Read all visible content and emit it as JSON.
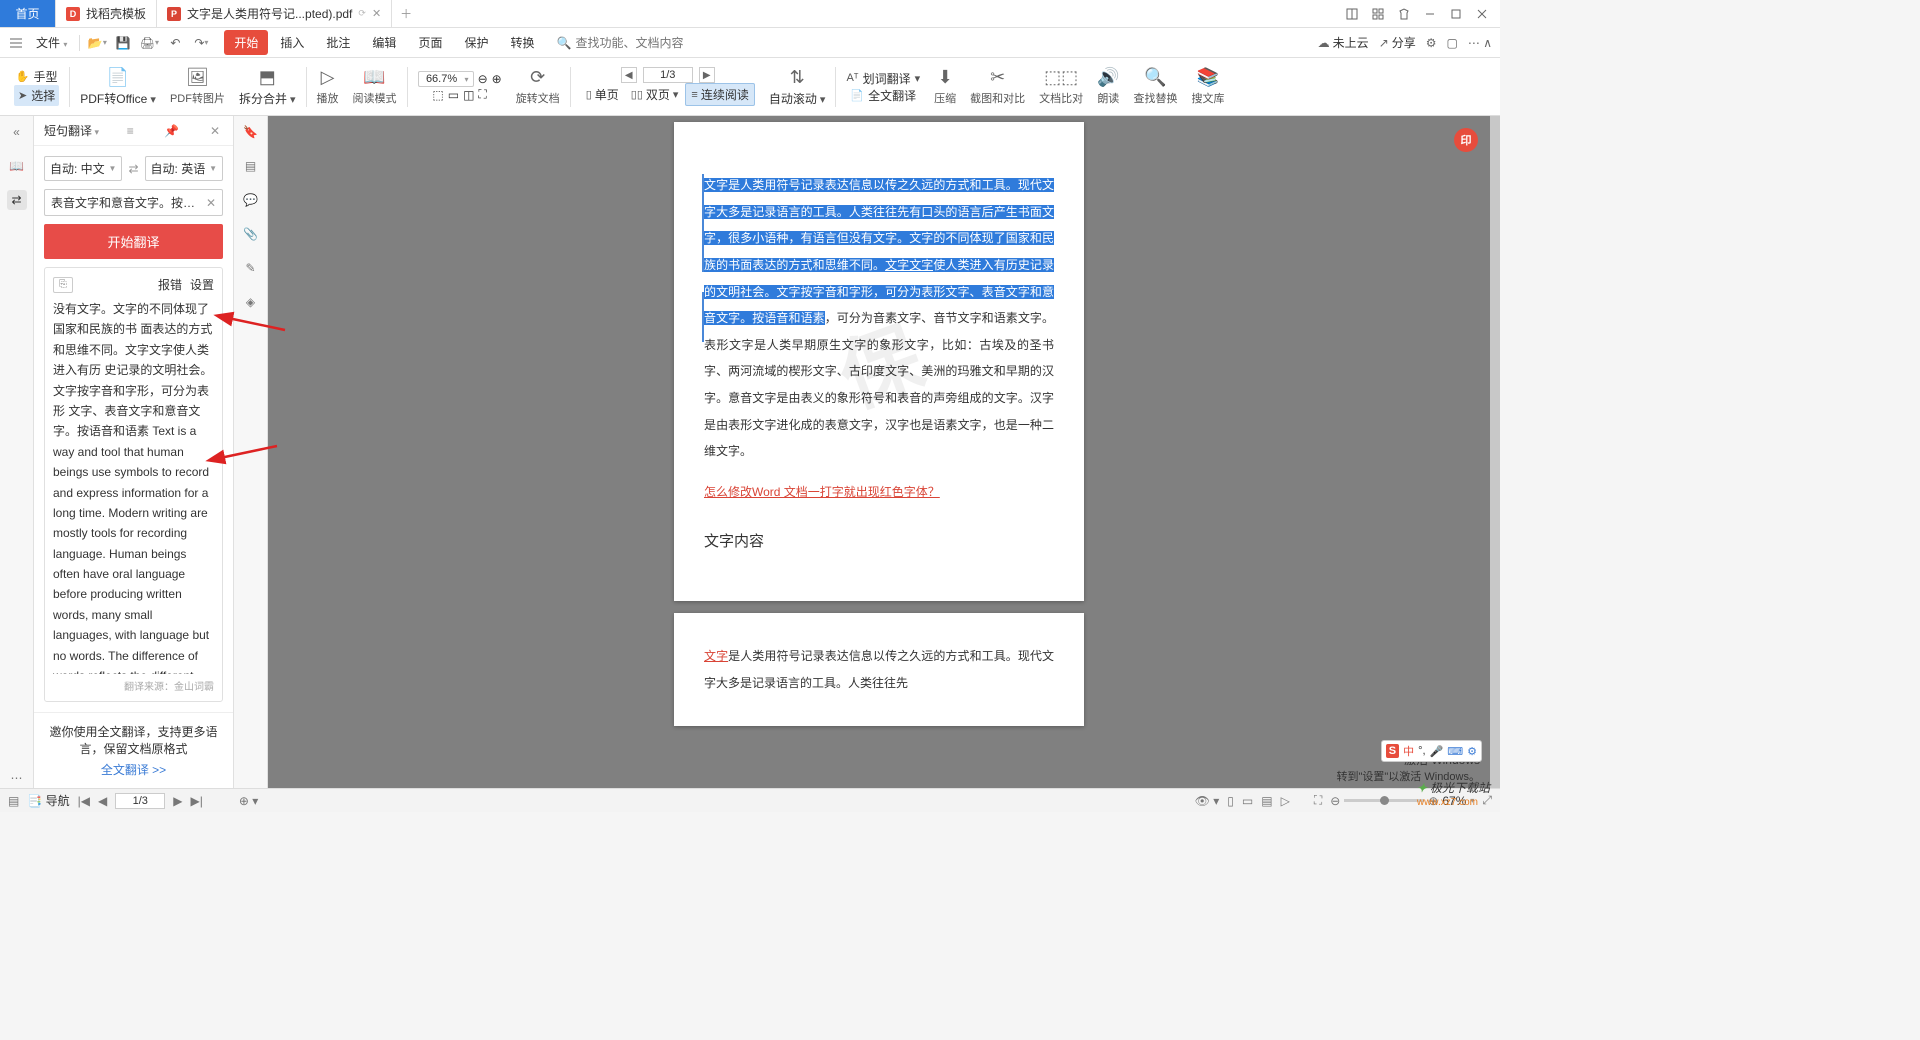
{
  "tabs": {
    "home": "首页",
    "t1": "找稻壳模板",
    "t2": "文字是人类用符号记...pted).pdf"
  },
  "menu": {
    "file": "文件",
    "tabs": [
      "开始",
      "插入",
      "批注",
      "编辑",
      "页面",
      "保护",
      "转换"
    ],
    "search_placeholder": "查找功能、文档内容",
    "cloud": "未上云",
    "share": "分享"
  },
  "ribbon": {
    "hand": "手型",
    "select": "选择",
    "pdf2office": "PDF转Office",
    "pdf2img": "PDF转图片",
    "split": "拆分合并",
    "play": "播放",
    "readmode": "阅读模式",
    "zoom": "66.7%",
    "rotate": "旋转文档",
    "single": "单页",
    "double": "双页",
    "continuous": "连续阅读",
    "autoscroll": "自动滚动",
    "page": "1/3",
    "wordtrans": "划词翻译",
    "fulltrans": "全文翻译",
    "compress": "压缩",
    "screenshot": "截图和对比",
    "compare": "文档比对",
    "read": "朗读",
    "findreplace": "查找替换",
    "search": "搜文库"
  },
  "trans": {
    "title": "短句翻译",
    "lang_from": "自动: 中文",
    "lang_to": "自动: 英语",
    "src_text": "表音文字和意音文字。按语音和语素",
    "btn": "开始翻译",
    "report": "报错",
    "settings": "设置",
    "result_cn": "没有文字。文字的不同体现了国家和民族的书 面表达的方式和思维不同。文字文字使人类进入有历 史记录的文明社会。文字按字音和字形，可分为表形 文字、表音文字和意音文字。按语音和语素 ",
    "result_en": "Text is a way and tool that human beings use symbols to record and express information for a long time. Modern writing are mostly tools for recording language. Human beings often have oral language before producing written words, many small languages, with language but no words. The difference of words reflects the different ways and thinking of the country and the nation. Words make",
    "source": "翻译来源：金山词霸",
    "footer_msg": "邀你使用全文翻译，支持更多语言，保留文档原格式",
    "footer_link": "全文翻译 >>"
  },
  "doc": {
    "highlighted": "文字是人类用符号记录表达信息以传之久远的方式和工具。现代文字大多是记录语言的工具。人类往往先有口头的语言后产生书面文字，很多小语种，有语言但没有文字。文字的不同体现了国家和民族的书面表达的方式和思维不同。",
    "red1": "文字文字",
    "hl2": "使人类进入有历史记录的文明社会。文字按字音和字形，可分为表形文字、表音文字和意音文字。按语音和语素",
    "rest": "，可分为音素文字、音节文字和语素文字。表形文字是人类早期原生文字的象形文字，比如：古埃及的圣书字、两河流域的楔形文字、古印度文字、美洲的玛雅文和早期的汉字。意音文字是由表义的象形符号和表音的声旁组成的文字。汉字是由表形文字进化成的表意文字，汉字也是语素文字，也是一种二维文字。",
    "link": "怎么修改Word 文档一打字就出现红色字体？",
    "section": "文字内容",
    "watermark": "保",
    "p2_red": "文字",
    "p2_rest": "是人类用符号记录表达信息以传之久远的方式和工具。现代文字大多是记录语言的工具。人类往往先"
  },
  "status": {
    "nav": "导航",
    "page": "1/3",
    "zoom": "67%"
  },
  "activate": {
    "l1": "激活 Windows",
    "l2": "转到\"设置\"以激活 Windows。"
  },
  "brand": {
    "name": "极光下载站",
    "url": "www.xz7.com"
  },
  "ime": {
    "zhong": "中"
  }
}
